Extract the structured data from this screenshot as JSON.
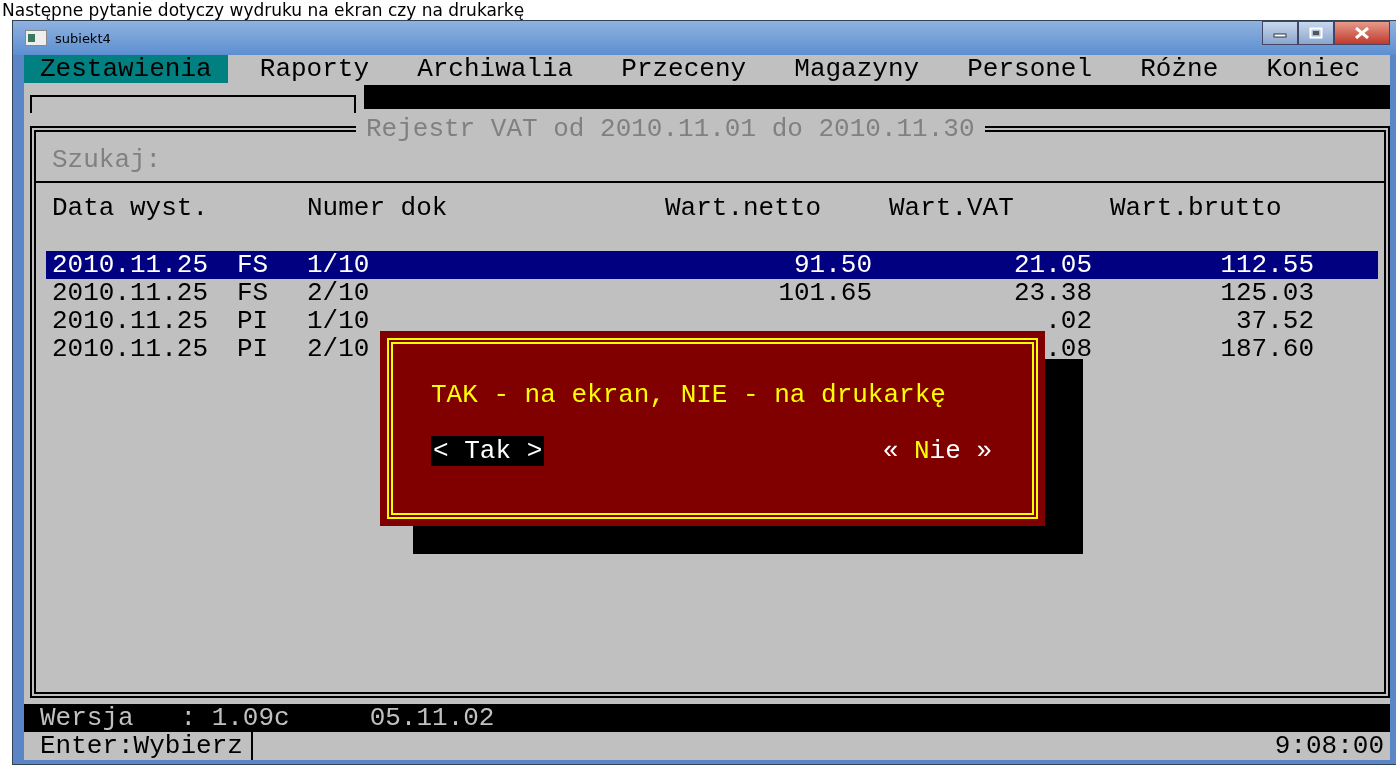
{
  "caption": "Następne pytanie dotyczy wydruku na ekran czy na drukarkę",
  "window": {
    "title": "subiekt4"
  },
  "menu": [
    {
      "label": "Zestawienia",
      "selected": true
    },
    {
      "label": "Raporty",
      "selected": false
    },
    {
      "label": "Archiwalia",
      "selected": false
    },
    {
      "label": "Przeceny",
      "selected": false
    },
    {
      "label": "Magazyny",
      "selected": false
    },
    {
      "label": "Personel",
      "selected": false
    },
    {
      "label": "Różne",
      "selected": false
    },
    {
      "label": "Koniec",
      "selected": false
    }
  ],
  "register": {
    "title": "Rejestr VAT od 2010.11.01 do 2010.11.30",
    "search_label": "Szukaj:",
    "columns": [
      "Data wyst.",
      "Numer dok",
      "Wart.netto",
      "Wart.VAT",
      "Wart.brutto"
    ],
    "rows": [
      {
        "date": "2010.11.25",
        "type": "FS",
        "number": "1/10",
        "net": "91.50",
        "vat": "21.05",
        "gross": "112.55",
        "selected": true
      },
      {
        "date": "2010.11.25",
        "type": "FS",
        "number": "2/10",
        "net": "101.65",
        "vat": "23.38",
        "gross": "125.03",
        "selected": false
      },
      {
        "date": "2010.11.25",
        "type": "PI",
        "number": "1/10",
        "vat": ".02",
        "gross": "37.52",
        "selected": false
      },
      {
        "date": "2010.11.25",
        "type": "PI",
        "number": "2/10",
        "vat": ".08",
        "gross": "187.60",
        "selected": false
      }
    ]
  },
  "dialog": {
    "message": "TAK - na ekran, NIE - na drukarkę",
    "buttons": [
      {
        "prefix": "< ",
        "hotkey": "T",
        "rest": "ak >",
        "selected": true
      },
      {
        "prefix": "« ",
        "hotkey": "N",
        "rest": "ie »",
        "selected": false
      }
    ]
  },
  "status": {
    "version": "Wersja   : 1.09c",
    "date": "05.11.02",
    "hint": "Enter:Wybierz",
    "time": "9:08:00"
  }
}
